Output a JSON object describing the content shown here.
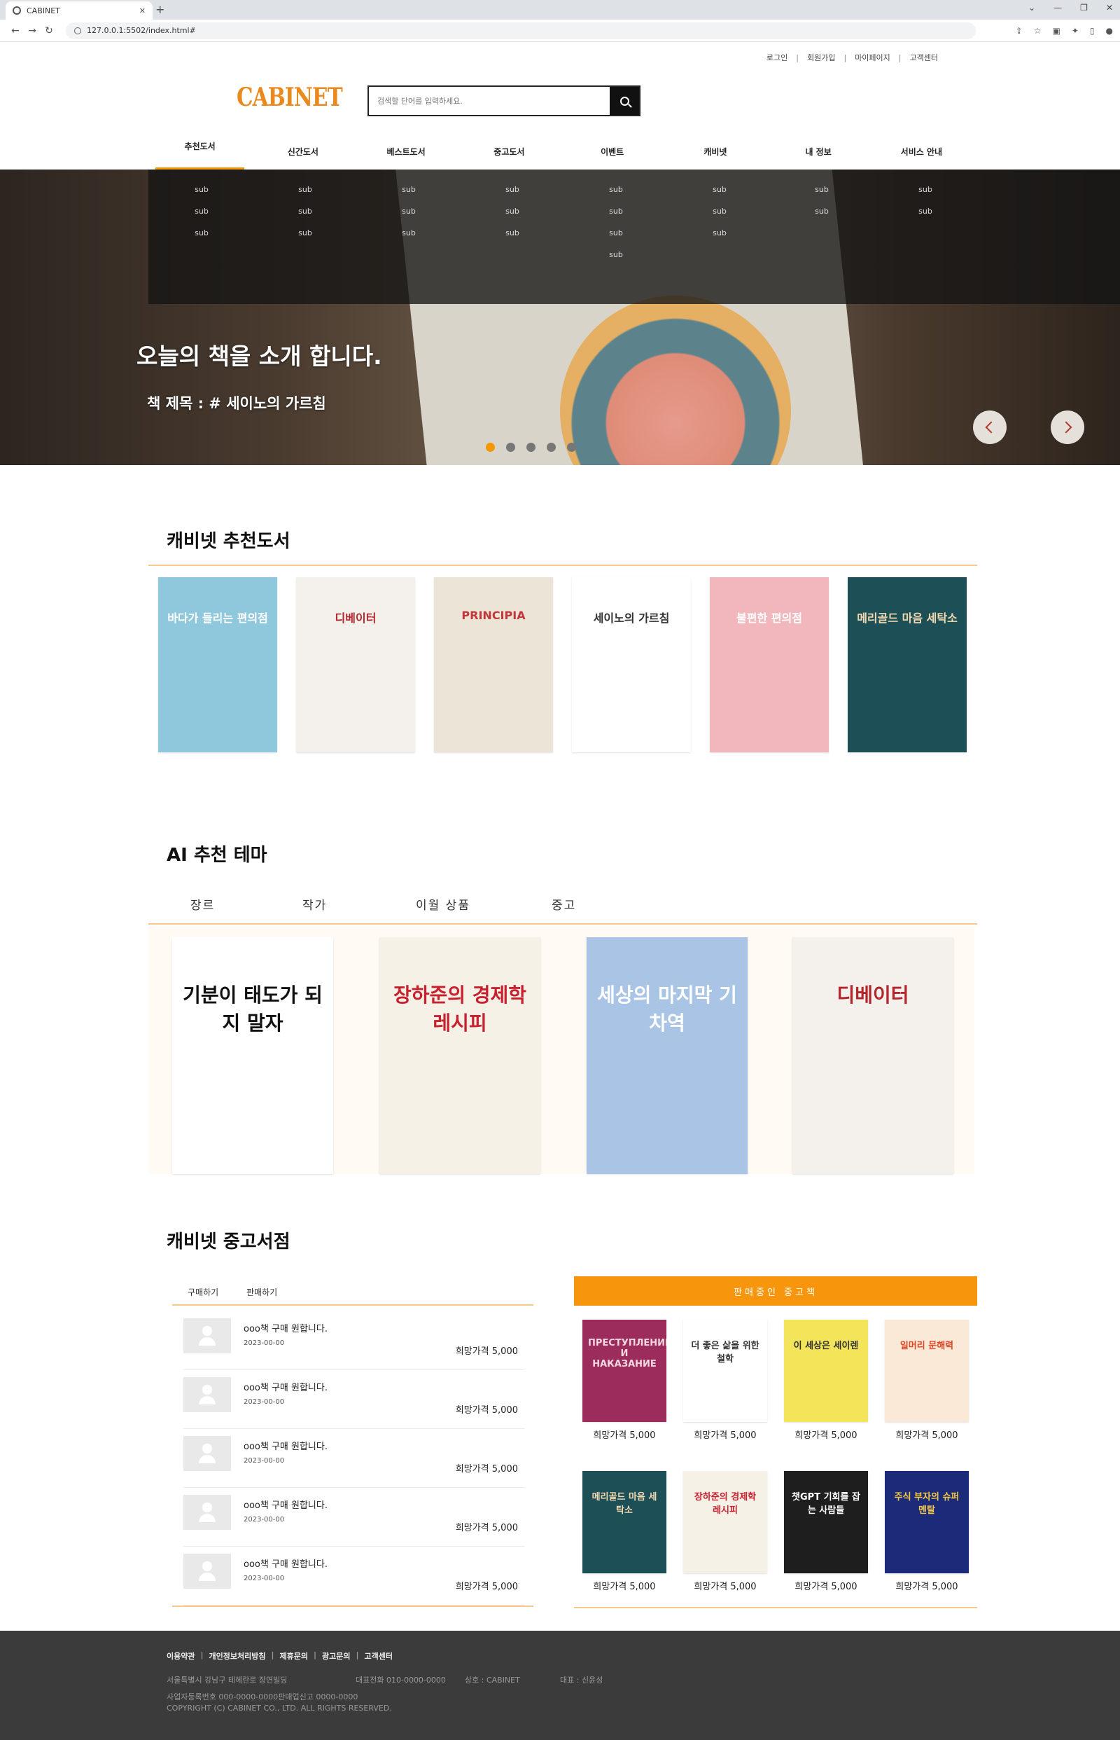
{
  "browser": {
    "tab_title": "CABINET",
    "url": "127.0.0.1:5502/index.html#"
  },
  "util_links": [
    "로그인",
    "회원가입",
    "마이페이지",
    "고객센터"
  ],
  "logo": "CABINET",
  "search": {
    "placeholder": "검색할 단어를 입력하세요."
  },
  "gnb": [
    "추천도서",
    "신간도서",
    "베스트도서",
    "중고도서",
    "이벤트",
    "캐비넷",
    "내 정보",
    "서비스 안내"
  ],
  "dropdown": {
    "label": "sub",
    "counts": [
      3,
      3,
      3,
      3,
      4,
      3,
      2,
      2
    ]
  },
  "hero": {
    "title": "오늘의 책을 소개 합니다.",
    "subtitle": "책 제목 : # 세이노의 가르침",
    "dots": 5,
    "active_dot": 0
  },
  "recommend": {
    "title": "캐비넷 추천도서",
    "books": [
      {
        "text": "바다가 들리는 편의점",
        "bg": "#8fc8dc",
        "fg": "#ffffff"
      },
      {
        "text": "디베이터",
        "bg": "#f4f1ec",
        "fg": "#b3262d"
      },
      {
        "text": "PRINCIPIA",
        "bg": "#ece5d7",
        "fg": "#c2373a"
      },
      {
        "text": "세이노의 가르침",
        "bg": "#ffffff",
        "fg": "#333333"
      },
      {
        "text": "불편한 편의점",
        "bg": "#f2b7bd",
        "fg": "#ffffff"
      },
      {
        "text": "메리골드 마음 세탁소",
        "bg": "#1d4f57",
        "fg": "#f3d9b0"
      }
    ]
  },
  "ai": {
    "title": "AI 추천 테마",
    "tabs": [
      "장르",
      "작가",
      "이월 상품",
      "중고"
    ],
    "books": [
      {
        "text": "기분이 태도가 되지 말자",
        "bg": "#ffffff",
        "fg": "#111111"
      },
      {
        "text": "장하준의 경제학 레시피",
        "bg": "#f6f1e6",
        "fg": "#c7202f"
      },
      {
        "text": "세상의 마지막 기차역",
        "bg": "#a9c4e4",
        "fg": "#ffffff"
      },
      {
        "text": "디베이터",
        "bg": "#f4f1ec",
        "fg": "#b3262d"
      }
    ]
  },
  "used": {
    "title": "캐비넷 중고서점",
    "tabs": [
      "구매하기",
      "판매하기"
    ],
    "rows": [
      {
        "title": "ooo책 구매 원합니다.",
        "date": "2023-00-00",
        "price": "희망가격 5,000"
      },
      {
        "title": "ooo책 구매 원합니다.",
        "date": "2023-00-00",
        "price": "희망가격 5,000"
      },
      {
        "title": "ooo책 구매 원합니다.",
        "date": "2023-00-00",
        "price": "희망가격 5,000"
      },
      {
        "title": "ooo책 구매 원합니다.",
        "date": "2023-00-00",
        "price": "희망가격 5,000"
      },
      {
        "title": "ooo책 구매 원합니다.",
        "date": "2023-00-00",
        "price": "희망가격 5,000"
      }
    ],
    "sale_title": "판매중인 중고책",
    "sale_books": [
      {
        "text": "ПРЕСТУПЛЕНИЕ И НАКАЗАНИЕ",
        "bg": "#9b2c5c",
        "fg": "#f3d6e0",
        "price": "희망가격 5,000"
      },
      {
        "text": "더 좋은 삶을 위한 철학",
        "bg": "#ffffff",
        "fg": "#333333",
        "price": "희망가격 5,000"
      },
      {
        "text": "이 세상은 세이렌",
        "bg": "#f3e45a",
        "fg": "#333333",
        "price": "희망가격 5,000"
      },
      {
        "text": "일머리 문해력",
        "bg": "#fbe9d8",
        "fg": "#e04626",
        "price": "희망가격 5,000"
      },
      {
        "text": "메리골드 마음 세탁소",
        "bg": "#1d4f57",
        "fg": "#f3d9b0",
        "price": "희망가격 5,000"
      },
      {
        "text": "장하준의 경제학 레시피",
        "bg": "#f6f1e6",
        "fg": "#c7202f",
        "price": "희망가격 5,000"
      },
      {
        "text": "챗GPT 기회를 잡는 사람들",
        "bg": "#1e1e1e",
        "fg": "#ffffff",
        "price": "희망가격 5,000"
      },
      {
        "text": "주식 부자의 슈퍼 멘탈",
        "bg": "#1c2a7a",
        "fg": "#f6c945",
        "price": "희망가격 5,000"
      }
    ]
  },
  "footer": {
    "links": [
      "이용약관",
      "개인정보처리방침",
      "제휴문의",
      "광고문의",
      "고객센터"
    ],
    "address": "서울특별시 강남구 테헤란로 장연빌딩",
    "phone": "대표전화 010-0000-0000",
    "company": "상호 : CABINET",
    "ceo": "대표 : 신윤성",
    "biz": "사업자등록번호 000-0000-0000판매업신고 0000-0000",
    "copyright": "COPYRIGHT (C) CABINET CO., LTD. ALL RIGHTS RESERVED."
  }
}
